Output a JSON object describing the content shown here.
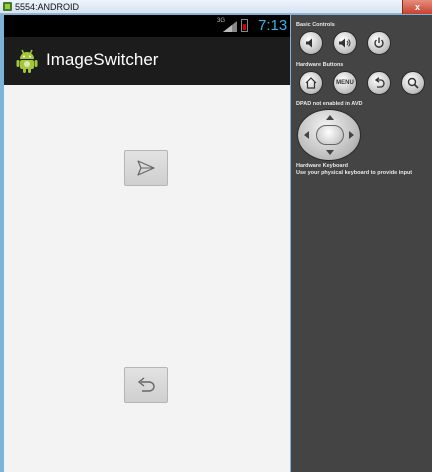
{
  "window": {
    "title": "5554:ANDROID",
    "close_glyph": "x"
  },
  "statusbar": {
    "network": "3G",
    "time": "7:13",
    "battery_color": "#cc0000",
    "clock_color": "#33b5e5"
  },
  "app": {
    "title": "ImageSwitcher",
    "next_button_icon": "send-icon",
    "back_button_icon": "undo-icon"
  },
  "controls": {
    "basic_label": "Basic Controls",
    "hardware_buttons_label": "Hardware Buttons",
    "menu_label": "MENU",
    "dpad_label": "DPAD not enabled in AVD",
    "keyboard_label": "Hardware Keyboard",
    "keyboard_hint": "Use your physical keyboard to provide input"
  }
}
